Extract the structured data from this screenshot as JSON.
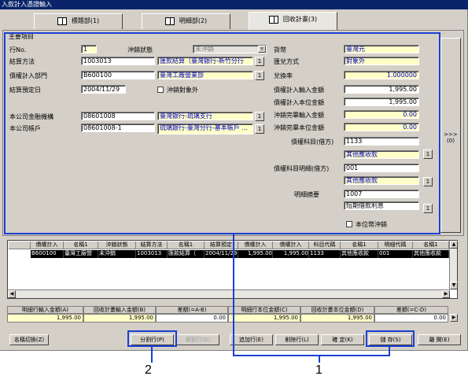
{
  "window": {
    "title": "入款計入憑證輸入"
  },
  "tabs": [
    {
      "label": "標題部(1)"
    },
    {
      "label": "明細部(2)"
    },
    {
      "label": "回收計畫(3)"
    }
  ],
  "main": {
    "group_title": "主要項目",
    "row_no": {
      "label": "行No.",
      "value": "1"
    },
    "offset_status": {
      "label": "沖銷狀態",
      "value": "未沖銷"
    },
    "settle_method": {
      "label": "結算方法",
      "code": "1003013",
      "name": "匯款結算（臺灣銀行-新竹分行"
    },
    "debt_dept": {
      "label": "債權計入部門",
      "code": "B600100",
      "name": "臺灣工廠營業部"
    },
    "settle_date": {
      "label": "結算預定日",
      "value": "2004/11/29"
    },
    "offset_target": {
      "label": "沖銷對象外"
    },
    "company_bank": {
      "label": "本公司金融機構",
      "code": "08601008",
      "name": "臺灣銀行-琉璃支行"
    },
    "company_account": {
      "label": "本公司帳戶",
      "code": "08601008-1",
      "name": "琉璃銀行-臺灣分行-基本帳戶 ..."
    },
    "currency": {
      "label": "貨幣",
      "value": "臺灣元"
    },
    "exchange_method": {
      "label": "匯兌方式",
      "value": "對象外"
    },
    "exchange_rate": {
      "label": "兌換率",
      "value": "1.000000"
    },
    "debt_input_amount": {
      "label": "債權計入輸入金額",
      "value": "1,995.00"
    },
    "debt_local_amount": {
      "label": "債權計入本位金額",
      "value": "1,995.00"
    },
    "offset_input_amount": {
      "label": "沖銷完畢輸入金額",
      "value": "0.00"
    },
    "offset_local_amount": {
      "label": "沖銷完畢本位金額",
      "value": "0.00"
    },
    "debit_account": {
      "label": "債權科目(借方)",
      "code": "1133",
      "name": "其他應收款"
    },
    "debit_detail": {
      "label": "債權科目明細(借方)",
      "code": "001",
      "name": "其他應收款"
    },
    "summary": {
      "label": "明細摘要",
      "code": "1007",
      "name": "短期借款利息"
    },
    "local_currency_offset": {
      "label": "本位幣沖銷"
    },
    "side_button": ">>>\n(0)",
    "one": "1"
  },
  "grid": {
    "headers": [
      "債權計入",
      "名稱1",
      "沖銷狀態",
      "結算方法",
      "名稱1",
      "結算預定",
      "債權計入",
      "債權計入",
      "科目代碼",
      "名稱1",
      "明細代碼",
      "名稱1"
    ],
    "row": [
      "B600100",
      "臺灣工廠營",
      "未沖銷",
      "1003013",
      "匯款結算（",
      "2004/11/29",
      "1,995.00",
      "1,995.00",
      "1133",
      "其他應收款",
      "001",
      "其他應收款"
    ]
  },
  "totals": {
    "headers": [
      "明細行輸入金額(A)",
      "回收計畫輸入金額(B)",
      "差額(=A-B)",
      "明細行本位金額(C)",
      "回收計畫本位金額(D)",
      "差額(=C-D)"
    ],
    "values": [
      "1,995.00",
      "1,995.00",
      "0.00",
      "1,995.00",
      "1,995.00",
      "0.00"
    ]
  },
  "buttons": {
    "name_switch": "名稱切換(Z)",
    "split_row": "分割行(P)",
    "copy_row": "複製行(D)",
    "add_row": "追加行(E)",
    "delete_row": "削除行(L)",
    "confirm": "確 定(K)",
    "save": "儲 存(S)",
    "close": "離 開(E)"
  },
  "callouts": {
    "one": "1",
    "two": "2"
  }
}
